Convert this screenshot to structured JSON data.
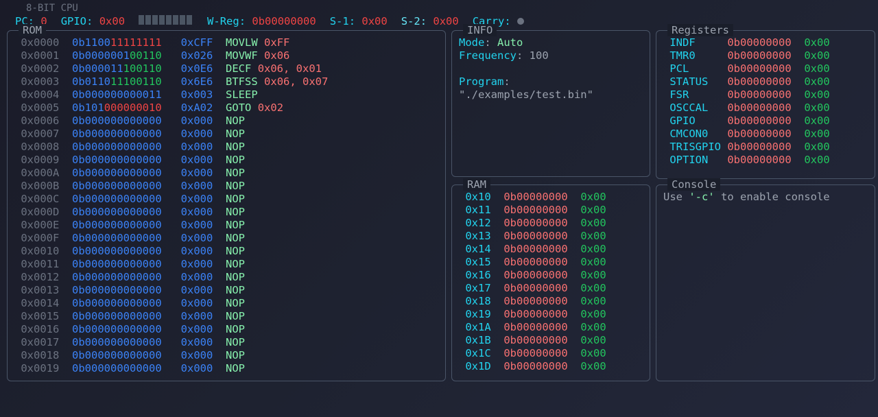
{
  "title": "8-BIT CPU",
  "status": {
    "pc_label": "PC:",
    "pc": "0",
    "gpio_label": "GPIO:",
    "gpio": "0x00",
    "bars": [
      0,
      0,
      0,
      0,
      0,
      0,
      0,
      0
    ],
    "wreg_label": "W-Reg:",
    "wreg": "0b00000000",
    "s1_label": "S-1:",
    "s1": "0x00",
    "s2_label": "S-2:",
    "s2": "0x00",
    "carry_label": "Carry:"
  },
  "panels": {
    "rom": "ROM",
    "registers": "Registers",
    "info": "INFO",
    "ram": "RAM",
    "console": "Console"
  },
  "rom": [
    {
      "addr": "0x0000",
      "bin_p": "0b1100",
      "bin_hi": "11111111",
      "hex": "0xCFF",
      "mnem": "MOVLW",
      "arg": "0xFF"
    },
    {
      "addr": "0x0001",
      "bin_p": "0b0000001",
      "bin_g": "00110",
      "hex": "0x026",
      "mnem": "MOVWF",
      "arg": "0x06"
    },
    {
      "addr": "0x0002",
      "bin_p": "0b000011",
      "bin_g": "100110",
      "hex": "0x0E6",
      "mnem": "DECF",
      "arg": "0x06, 0x01"
    },
    {
      "addr": "0x0003",
      "bin_p": "0b0110",
      "bin_g": "11100110",
      "hex": "0x6E6",
      "mnem": "BTFSS",
      "arg": "0x06, 0x07"
    },
    {
      "addr": "0x0004",
      "bin_p": "0b000000000011",
      "hex": "0x003",
      "mnem": "SLEEP",
      "arg": ""
    },
    {
      "addr": "0x0005",
      "bin_p": "0b101",
      "bin_hi": "000000010",
      "hex": "0xA02",
      "mnem": "GOTO",
      "arg": "0x02"
    },
    {
      "addr": "0x0006",
      "bin_p": "0b000000000000",
      "hex": "0x000",
      "mnem": "NOP",
      "arg": ""
    },
    {
      "addr": "0x0007",
      "bin_p": "0b000000000000",
      "hex": "0x000",
      "mnem": "NOP",
      "arg": ""
    },
    {
      "addr": "0x0008",
      "bin_p": "0b000000000000",
      "hex": "0x000",
      "mnem": "NOP",
      "arg": ""
    },
    {
      "addr": "0x0009",
      "bin_p": "0b000000000000",
      "hex": "0x000",
      "mnem": "NOP",
      "arg": ""
    },
    {
      "addr": "0x000A",
      "bin_p": "0b000000000000",
      "hex": "0x000",
      "mnem": "NOP",
      "arg": ""
    },
    {
      "addr": "0x000B",
      "bin_p": "0b000000000000",
      "hex": "0x000",
      "mnem": "NOP",
      "arg": ""
    },
    {
      "addr": "0x000C",
      "bin_p": "0b000000000000",
      "hex": "0x000",
      "mnem": "NOP",
      "arg": ""
    },
    {
      "addr": "0x000D",
      "bin_p": "0b000000000000",
      "hex": "0x000",
      "mnem": "NOP",
      "arg": ""
    },
    {
      "addr": "0x000E",
      "bin_p": "0b000000000000",
      "hex": "0x000",
      "mnem": "NOP",
      "arg": ""
    },
    {
      "addr": "0x000F",
      "bin_p": "0b000000000000",
      "hex": "0x000",
      "mnem": "NOP",
      "arg": ""
    },
    {
      "addr": "0x0010",
      "bin_p": "0b000000000000",
      "hex": "0x000",
      "mnem": "NOP",
      "arg": ""
    },
    {
      "addr": "0x0011",
      "bin_p": "0b000000000000",
      "hex": "0x000",
      "mnem": "NOP",
      "arg": ""
    },
    {
      "addr": "0x0012",
      "bin_p": "0b000000000000",
      "hex": "0x000",
      "mnem": "NOP",
      "arg": ""
    },
    {
      "addr": "0x0013",
      "bin_p": "0b000000000000",
      "hex": "0x000",
      "mnem": "NOP",
      "arg": ""
    },
    {
      "addr": "0x0014",
      "bin_p": "0b000000000000",
      "hex": "0x000",
      "mnem": "NOP",
      "arg": ""
    },
    {
      "addr": "0x0015",
      "bin_p": "0b000000000000",
      "hex": "0x000",
      "mnem": "NOP",
      "arg": ""
    },
    {
      "addr": "0x0016",
      "bin_p": "0b000000000000",
      "hex": "0x000",
      "mnem": "NOP",
      "arg": ""
    },
    {
      "addr": "0x0017",
      "bin_p": "0b000000000000",
      "hex": "0x000",
      "mnem": "NOP",
      "arg": ""
    },
    {
      "addr": "0x0018",
      "bin_p": "0b000000000000",
      "hex": "0x000",
      "mnem": "NOP",
      "arg": ""
    },
    {
      "addr": "0x0019",
      "bin_p": "0b000000000000",
      "hex": "0x000",
      "mnem": "NOP",
      "arg": ""
    }
  ],
  "registers": [
    {
      "name": "INDF",
      "bin": "0b00000000",
      "hex": "0x00"
    },
    {
      "name": "TMR0",
      "bin": "0b00000000",
      "hex": "0x00"
    },
    {
      "name": "PCL",
      "bin": "0b00000000",
      "hex": "0x00"
    },
    {
      "name": "STATUS",
      "bin": "0b00000000",
      "hex": "0x00"
    },
    {
      "name": "FSR",
      "bin": "0b00000000",
      "hex": "0x00"
    },
    {
      "name": "OSCCAL",
      "bin": "0b00000000",
      "hex": "0x00"
    },
    {
      "name": "GPIO",
      "bin": "0b00000000",
      "hex": "0x00"
    },
    {
      "name": "CMCON0",
      "bin": "0b00000000",
      "hex": "0x00"
    },
    {
      "name": "TRISGPIO",
      "bin": "0b00000000",
      "hex": "0x00"
    },
    {
      "name": "OPTION",
      "bin": "0b00000000",
      "hex": "0x00"
    }
  ],
  "info": {
    "mode_label": "Mode",
    "mode_val": "Auto",
    "freq_label": "Frequency",
    "freq_val": "100",
    "prog_label": "Program",
    "prog_val": "\"./examples/test.bin\""
  },
  "ram": [
    {
      "addr": "0x10",
      "bin": "0b00000000",
      "hex": "0x00"
    },
    {
      "addr": "0x11",
      "bin": "0b00000000",
      "hex": "0x00"
    },
    {
      "addr": "0x12",
      "bin": "0b00000000",
      "hex": "0x00"
    },
    {
      "addr": "0x13",
      "bin": "0b00000000",
      "hex": "0x00"
    },
    {
      "addr": "0x14",
      "bin": "0b00000000",
      "hex": "0x00"
    },
    {
      "addr": "0x15",
      "bin": "0b00000000",
      "hex": "0x00"
    },
    {
      "addr": "0x16",
      "bin": "0b00000000",
      "hex": "0x00"
    },
    {
      "addr": "0x17",
      "bin": "0b00000000",
      "hex": "0x00"
    },
    {
      "addr": "0x18",
      "bin": "0b00000000",
      "hex": "0x00"
    },
    {
      "addr": "0x19",
      "bin": "0b00000000",
      "hex": "0x00"
    },
    {
      "addr": "0x1A",
      "bin": "0b00000000",
      "hex": "0x00"
    },
    {
      "addr": "0x1B",
      "bin": "0b00000000",
      "hex": "0x00"
    },
    {
      "addr": "0x1C",
      "bin": "0b00000000",
      "hex": "0x00"
    },
    {
      "addr": "0x1D",
      "bin": "0b00000000",
      "hex": "0x00"
    }
  ],
  "console": {
    "text_a": "Use ",
    "flag": "'-c'",
    "text_b": " to enable console"
  }
}
